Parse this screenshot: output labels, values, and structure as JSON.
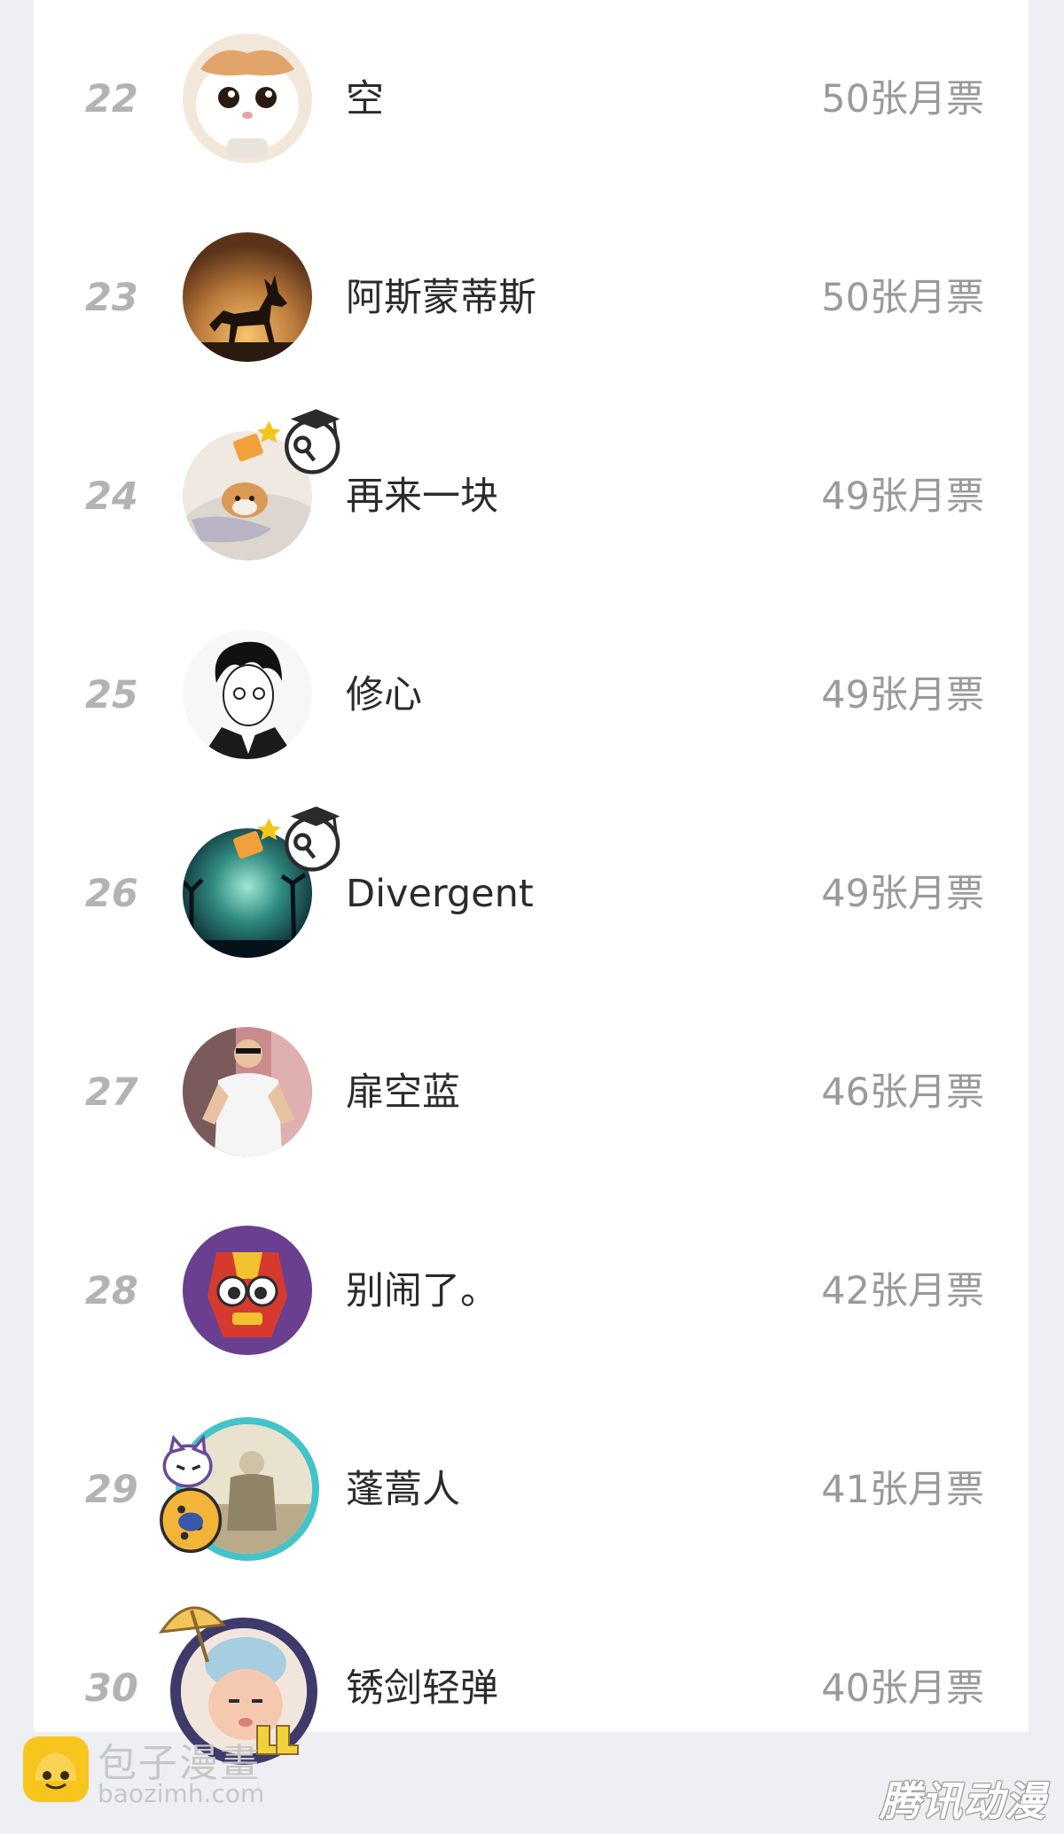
{
  "leaderboard": {
    "rows": [
      {
        "rank": "22",
        "name": "空",
        "votes": "50张月票"
      },
      {
        "rank": "23",
        "name": "阿斯蒙蒂斯",
        "votes": "50张月票"
      },
      {
        "rank": "24",
        "name": "再来一块",
        "votes": "49张月票"
      },
      {
        "rank": "25",
        "name": "修心",
        "votes": "49张月票"
      },
      {
        "rank": "26",
        "name": "Divergent",
        "votes": "49张月票"
      },
      {
        "rank": "27",
        "name": "扉空蓝",
        "votes": "46张月票"
      },
      {
        "rank": "28",
        "name": "别闹了。",
        "votes": "42张月票"
      },
      {
        "rank": "29",
        "name": "蓬蒿人",
        "votes": "41张月票"
      },
      {
        "rank": "30",
        "name": "锈剑轻弹",
        "votes": "40张月票"
      }
    ]
  },
  "watermark": {
    "site_name": "包子漫畫",
    "site_url": "baozimh.com",
    "brand": "腾讯动漫"
  },
  "colors": {
    "background": "#eeeff2",
    "card": "#ffffff",
    "rank_text": "#b3b3b3",
    "vote_text": "#9a9a9a",
    "name_text": "#2b2b2b"
  }
}
